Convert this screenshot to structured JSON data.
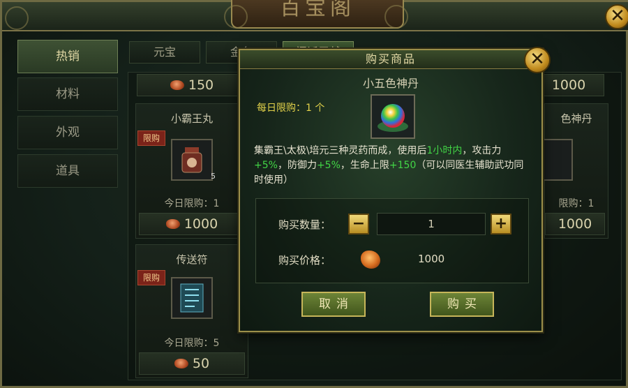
{
  "window": {
    "title": "百宝阁"
  },
  "sidebar": {
    "tabs": [
      {
        "label": "热销",
        "active": true
      },
      {
        "label": "材料"
      },
      {
        "label": "外观"
      },
      {
        "label": "道具"
      }
    ]
  },
  "top_tabs": [
    {
      "label": "元宝"
    },
    {
      "label": "金条"
    },
    {
      "label": "门派贡献",
      "active": true
    }
  ],
  "cards": {
    "row1_left_price": "150",
    "row1_right_price": "1000",
    "xiaobawang": {
      "name": "小霸王丸",
      "tag": "限购",
      "count": "5",
      "daily_limit": "今日限购：1",
      "price": "1000"
    },
    "right_card": {
      "name": "色神丹",
      "daily_limit": "限购：1",
      "price": "1000"
    },
    "chuansong": {
      "name": "传送符",
      "tag": "限购",
      "daily_limit": "今日限购：5",
      "price": "50"
    }
  },
  "modal": {
    "title": "购买商品",
    "item_name": "小五色神丹",
    "daily_limit": "每日限购：1 个",
    "desc": {
      "p1": "集霸王\\太极\\培元三种灵药而成，使用后",
      "g1": "1小时内",
      "p2": "，攻击力",
      "g2": "+5%",
      "p3": "，防御力",
      "g3": "+5%",
      "p4": "，生命上限",
      "g4": "+150",
      "p5": "（可以同医生辅助武功同时使用）"
    },
    "qty_label": "购买数量：",
    "qty_value": "1",
    "minus": "−",
    "plus": "+",
    "price_label": "购买价格：",
    "price_value": "1000",
    "cancel": "取消",
    "buy": "购买"
  },
  "icons": {
    "close": "close-icon",
    "currency": "coin-icon"
  },
  "colors": {
    "accent_gold": "#c7b65a",
    "highlight_green": "#42d646",
    "limit_yellow": "#e3d24a",
    "tag_red": "#7b2319"
  }
}
